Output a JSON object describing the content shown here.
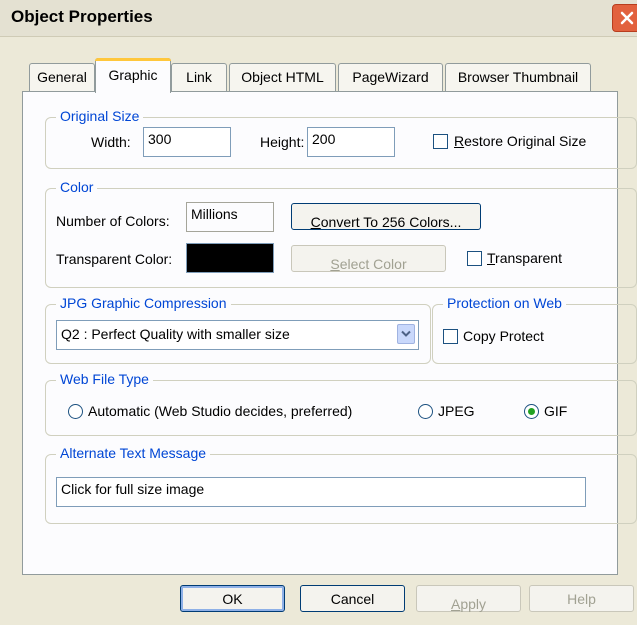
{
  "window": {
    "title": "Object Properties",
    "close_icon": "close-icon"
  },
  "tabs": [
    {
      "label": "General",
      "active": false
    },
    {
      "label": "Graphic",
      "active": true
    },
    {
      "label": "Link",
      "active": false
    },
    {
      "label": "Object HTML",
      "active": false
    },
    {
      "label": "PageWizard",
      "active": false
    },
    {
      "label": "Browser Thumbnail",
      "active": false
    }
  ],
  "original_size": {
    "legend": "Original Size",
    "width_label": "Width:",
    "width_value": "300",
    "height_label": "Height:",
    "height_value": "200",
    "restore_first": "R",
    "restore_rest": "estore Original Size",
    "restore_checked": false
  },
  "color": {
    "legend": "Color",
    "num_colors_label": "Number of Colors:",
    "num_colors_value": "Millions",
    "convert_first": "C",
    "convert_rest": "onvert To 256 Colors...",
    "transparent_color_label": "Transparent Color:",
    "transparent_swatch_color": "#000000",
    "select_first": "S",
    "select_rest": "elect Color",
    "transparent_first": "T",
    "transparent_rest": "ransparent",
    "transparent_checked": false
  },
  "jpg_compression": {
    "legend": "JPG Graphic Compression",
    "selected": "Q2 : Perfect Quality with smaller size"
  },
  "protection": {
    "legend": "Protection on Web",
    "copy_protect_label": "Copy Protect",
    "copy_protect_checked": false
  },
  "web_file_type": {
    "legend": "Web File Type",
    "options": [
      "Automatic (Web Studio decides, preferred)",
      "JPEG",
      "GIF"
    ],
    "selected": "GIF"
  },
  "alt_text": {
    "legend": "Alternate Text Message",
    "value": "Click for full size image"
  },
  "buttons": {
    "ok": "OK",
    "cancel": "Cancel",
    "apply_first": "A",
    "apply_rest": "pply",
    "help": "Help"
  },
  "colors": {
    "dialog_bg": "#ece9d8",
    "legend_text": "#0046d5",
    "radio_selected": "#21a121",
    "close_button": "#e2613e"
  }
}
